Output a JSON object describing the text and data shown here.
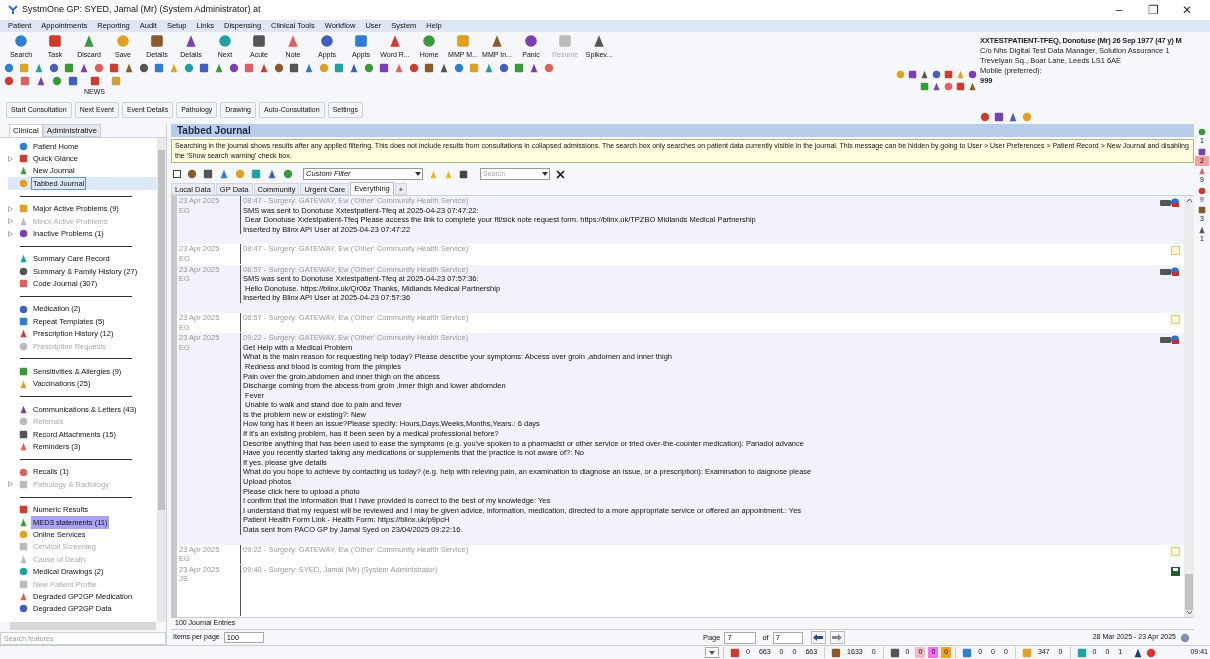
{
  "window": {
    "title": "SystmOne GP: SYED, Jamal (Mr) (System Administrator) at",
    "controls": [
      "–",
      "❐",
      "✕"
    ]
  },
  "menu": [
    "Patient",
    "Appointments",
    "Reporting",
    "Audit",
    "Setup",
    "Links",
    "Dispensing",
    "Clinical Tools",
    "Workflow",
    "User",
    "System",
    "Help"
  ],
  "toolbar": [
    {
      "label": "Search",
      "disabled": false
    },
    {
      "label": "Task",
      "disabled": false
    },
    {
      "label": "Discard",
      "disabled": false
    },
    {
      "label": "Save",
      "disabled": false
    },
    {
      "label": "Details",
      "disabled": false
    },
    {
      "label": "Details",
      "disabled": false
    },
    {
      "label": "Next",
      "disabled": false
    },
    {
      "label": "Acute",
      "disabled": false
    },
    {
      "label": "Note",
      "disabled": false
    },
    {
      "label": "Appts",
      "disabled": false
    },
    {
      "label": "Appts",
      "disabled": false
    },
    {
      "label": "Word R...",
      "disabled": false
    },
    {
      "label": "Home",
      "disabled": false
    },
    {
      "label": "MMP M...",
      "disabled": false
    },
    {
      "label": "MMP In...",
      "disabled": false
    },
    {
      "label": "Panic",
      "disabled": false
    },
    {
      "label": "Resume",
      "disabled": true
    },
    {
      "label": "Spikev...",
      "disabled": false
    }
  ],
  "news_label": "NEWS",
  "action_buttons": [
    "Start Consultation",
    "Next Event",
    "Event Details",
    "Pathology",
    "Drawing",
    "Auto-Consultation",
    "Settings"
  ],
  "patient": {
    "name": "XXTESTPATIENT-TFEQ, Donotuse (Mr) 26 Sep 1977 (47 y) M",
    "address": [
      "C/o Nhs Digital Test Data Manager, Solution Assurance 1",
      "Trevelyan Sq., Boar Lane, Leeds LS1 6AE"
    ],
    "phone_label": "Mobile (preferred):",
    "phone": "999"
  },
  "sidebar": {
    "tabs": [
      {
        "label": "Clinical",
        "selected": true
      },
      {
        "label": "Administrative",
        "selected": false
      }
    ],
    "groups": [
      [
        {
          "label": "Patient Home",
          "expandable": false,
          "disabled": false,
          "selected": false,
          "highlighted": false
        },
        {
          "label": "Quick Glance",
          "expandable": true,
          "disabled": false,
          "selected": false,
          "highlighted": false
        },
        {
          "label": "New Journal",
          "expandable": false,
          "disabled": false,
          "selected": false,
          "highlighted": false
        },
        {
          "label": "Tabbed Journal",
          "expandable": false,
          "disabled": false,
          "selected": true,
          "highlighted": false
        }
      ],
      [
        {
          "label": "Major Active Problems (9)",
          "expandable": true,
          "disabled": false,
          "selected": false,
          "highlighted": false
        },
        {
          "label": "Minor Active Problems",
          "expandable": true,
          "disabled": true,
          "selected": false,
          "highlighted": false
        },
        {
          "label": "Inactive Problems (1)",
          "expandable": true,
          "disabled": false,
          "selected": false,
          "highlighted": false
        }
      ],
      [
        {
          "label": "Summary Care Record",
          "expandable": false,
          "disabled": false,
          "selected": false,
          "highlighted": false
        },
        {
          "label": "Summary & Family History (27)",
          "expandable": false,
          "disabled": false,
          "selected": false,
          "highlighted": false
        },
        {
          "label": "Code Journal (307)",
          "expandable": false,
          "disabled": false,
          "selected": false,
          "highlighted": false
        }
      ],
      [
        {
          "label": "Medication (2)",
          "expandable": false,
          "disabled": false,
          "selected": false,
          "highlighted": false
        },
        {
          "label": "Repeat Templates (5)",
          "expandable": false,
          "disabled": false,
          "selected": false,
          "highlighted": false
        },
        {
          "label": "Prescription History (12)",
          "expandable": false,
          "disabled": false,
          "selected": false,
          "highlighted": false
        },
        {
          "label": "Prescription Requests",
          "expandable": false,
          "disabled": true,
          "selected": false,
          "highlighted": false
        }
      ],
      [
        {
          "label": "Sensitivities & Allergies (9)",
          "expandable": false,
          "disabled": false,
          "selected": false,
          "highlighted": false
        },
        {
          "label": "Vaccinations (25)",
          "expandable": false,
          "disabled": false,
          "selected": false,
          "highlighted": false
        }
      ],
      [
        {
          "label": "Communications & Letters (43)",
          "expandable": false,
          "disabled": false,
          "selected": false,
          "highlighted": false
        },
        {
          "label": "Referrals",
          "expandable": false,
          "disabled": true,
          "selected": false,
          "highlighted": false
        },
        {
          "label": "Record Attachments (15)",
          "expandable": false,
          "disabled": false,
          "selected": false,
          "highlighted": false
        },
        {
          "label": "Reminders (3)",
          "expandable": false,
          "disabled": false,
          "selected": false,
          "highlighted": false
        }
      ],
      [
        {
          "label": "Recalls (1)",
          "expandable": false,
          "disabled": false,
          "selected": false,
          "highlighted": false
        },
        {
          "label": "Pathology & Radiology",
          "expandable": true,
          "disabled": true,
          "selected": false,
          "highlighted": false
        }
      ],
      [
        {
          "label": "Numeric Results",
          "expandable": false,
          "disabled": false,
          "selected": false,
          "highlighted": false
        },
        {
          "label": "MED3 statements (11)",
          "expandable": false,
          "disabled": false,
          "selected": false,
          "highlighted": true
        },
        {
          "label": "Online Services",
          "expandable": false,
          "disabled": false,
          "selected": false,
          "highlighted": false
        },
        {
          "label": "Cervical Screening",
          "expandable": false,
          "disabled": true,
          "selected": false,
          "highlighted": false
        },
        {
          "label": "Cause of Death",
          "expandable": false,
          "disabled": true,
          "selected": false,
          "highlighted": false
        },
        {
          "label": "Medical Drawings (2)",
          "expandable": false,
          "disabled": false,
          "selected": false,
          "highlighted": false
        },
        {
          "label": "New Patient Profile",
          "expandable": false,
          "disabled": true,
          "selected": false,
          "highlighted": false
        },
        {
          "label": "Degraded GP2GP Medication",
          "expandable": false,
          "disabled": false,
          "selected": false,
          "highlighted": false
        },
        {
          "label": "Degraded GP2GP Data",
          "expandable": false,
          "disabled": false,
          "selected": false,
          "highlighted": false
        }
      ]
    ],
    "search": {
      "placeholder": "Search features"
    }
  },
  "journal": {
    "title": "Tabbed Journal",
    "warning": "Searching in the journal shows results after any applied filtering. This does not include results from consultations in collapsed admissions. The search box only searches on patient data currently visible in the journal. This message can be hidden by going to User > User Preferences > Patient Record > New Journal and disabling the 'Show search warning' check box.",
    "select_all_checked": false,
    "filter": "Custom Filter",
    "search_placeholder": "Search",
    "tabs": [
      {
        "label": "Local Data",
        "selected": false
      },
      {
        "label": "GP Data",
        "selected": false
      },
      {
        "label": "Community",
        "selected": false
      },
      {
        "label": "Urgent Care",
        "selected": false
      },
      {
        "label": "Everything",
        "selected": true
      },
      {
        "label": "+",
        "selected": false
      }
    ],
    "entries": [
      {
        "date": "23 Apr 2025",
        "user": "EG",
        "header": "08:47 - Surgery: GATEWAY, Ew ('Other' Community Health Service)",
        "kind": "message",
        "shaded": true,
        "lines": [
          "SMS was sent to Donotuse Xxtestpatient-Tfeq at 2025-04-23 07:47:22:",
          " Dear Donotuse Xxtestpatient-Tfeq Please access the link to complete your fit/sick note request form. https://blinx.uk/TPZBO Midlands Medical Partnership",
          "Inserted by Blinx API User at 2025-04-23 07:47:22"
        ]
      },
      {
        "date": "23 Apr 2025",
        "user": "EG",
        "header": "08:47 - Surgery: GATEWAY, Ew ('Other' Community Health Service)",
        "kind": "note",
        "shaded": false
      },
      {
        "date": "23 Apr 2025",
        "user": "EG",
        "header": "08:57 - Surgery: GATEWAY, Ew ('Other' Community Health Service)",
        "kind": "message",
        "shaded": true,
        "lines": [
          "SMS was sent to Donotuse Xxtestpatient-Tfeq at 2025-04-23 07:57:36:",
          " Hello Donotuse. https://blinx.uk/Qr06z Thanks, Midlands Medical Partnership",
          "Inserted by Blinx API User at 2025-04-23 07:57:36"
        ]
      },
      {
        "date": "23 Apr 2025",
        "user": "EG",
        "header": "08:57 - Surgery: GATEWAY, Ew ('Other' Community Health Service)",
        "kind": "note",
        "shaded": false
      },
      {
        "date": "23 Apr 2025",
        "user": "EG",
        "header": "09:22 - Surgery: GATEWAY, Ew ('Other' Community Health Service)",
        "kind": "message",
        "shaded": true,
        "lines": [
          "Get Help with a Medical Problem",
          "What is the main reason for requesting help today? Please describe your symptoms: Abcess over groin ,abdomen and inner thigh",
          " Redness and blood is coming from the pimples",
          "Pain over the groin,abdomen and inner thigh on the abcess",
          "Discharge coming from the abcess from groin ,inner thigh and lower abdomden",
          " Fever",
          " Unable to walk and stand due to pain and fever",
          "Is the problem new or existing?: New",
          "How long has it been an issue?Please specify: Hours,Days,Weeks,Months,Years.: 6 days",
          "If it's an existing problem, has it been seen by a medical professional before?",
          "Describe anything that has been used to ease the symptoms (e.g. you've spoken to a pharmacist or other service or tried over-the-counter medication): Panadol advance",
          "Have you recently started taking any medications or supplements that the practice is not aware of?: No",
          "If yes, please give details",
          "What do you hope to achieve by contacting us today? (e.g. help with releving pain, an examination to diagnose an issue, or a prescription): Examination to daignose please",
          "Upload photos",
          "Please click here to upload a photo",
          "I confirm that the information that I have provided is correct to the best of my knowledge: Yes",
          "I understand that my request will be reviewed and I may be given advice, information, medication, directed to a more appropriate service or offered an appointment.: Yes",
          "Patient Health Form Link - Health Form: https://blinx.uk/p9pcH",
          "Data sent from PACO GP by Jamal Syed on 23/04/2025 09:22:16."
        ]
      },
      {
        "date": "23 Apr 2025",
        "user": "EG",
        "header": "09:22 - Surgery: GATEWAY, Ew ('Other' Community Health Service)",
        "kind": "note",
        "shaded": false
      },
      {
        "date": "23 Apr 2025",
        "user": "JS",
        "header": "09:40 - Surgery: SYED, Jamal (Mr) (System Administrator)",
        "kind": "saved",
        "shaded": false
      }
    ],
    "entry_count": "100 Journal Entries",
    "items_per_page_label": "Items per page",
    "items_per_page": "100",
    "page_label": "Page",
    "page": "7",
    "of_label": "of",
    "page_total": "7",
    "date_range": "28 Mar 2025 - 23 Apr 2025"
  },
  "right_strip": [
    {
      "text": "1",
      "color": "#f3f6fb"
    },
    {
      "text": "2",
      "color": "#f4a0a0"
    },
    {
      "text": "9",
      "color": "#f3f6fb"
    },
    {
      "text": "!!",
      "color": "#f3f6fb"
    },
    {
      "text": "3",
      "color": "#f3f6fb"
    },
    {
      "text": "1",
      "color": "#f3f6fb"
    }
  ],
  "status_bar": {
    "groups": [
      [
        {
          "text": "0",
          "color": "#f3f6fb"
        },
        {
          "text": "663",
          "color": "#f3f6fb"
        },
        {
          "text": "0",
          "color": "#f3f6fb"
        },
        {
          "text": "0",
          "color": "#f3f6fb"
        },
        {
          "text": "663",
          "color": "#f3f6fb"
        }
      ],
      [
        {
          "text": "1633",
          "color": "#f3f6fb"
        },
        {
          "text": "0",
          "color": "#f3f6fb"
        }
      ],
      [
        {
          "text": "0",
          "color": "#f3f6fb"
        },
        {
          "text": "0",
          "color": "#f9b8c8"
        },
        {
          "text": "0",
          "color": "#f070f0"
        },
        {
          "text": "0",
          "color": "#f5a020"
        }
      ],
      [
        {
          "text": "0",
          "color": "#f3f6fb"
        },
        {
          "text": "0",
          "color": "#f3f6fb"
        },
        {
          "text": "0",
          "color": "#f3f6fb"
        }
      ],
      [
        {
          "text": "347",
          "color": "#f3f6fb"
        },
        {
          "text": "0",
          "color": "#f3f6fb"
        }
      ],
      [
        {
          "text": "0",
          "color": "#f3f6fb"
        },
        {
          "text": "0",
          "color": "#f3f6fb"
        },
        {
          "text": "1",
          "color": "#f3f6fb"
        }
      ]
    ],
    "time": "09:41"
  }
}
